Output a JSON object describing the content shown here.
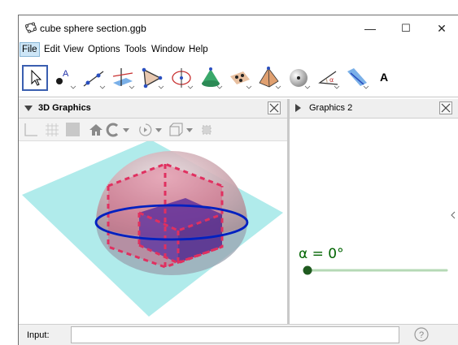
{
  "window": {
    "title": "cube sphere section.ggb",
    "minimize": "—",
    "maximize": "☐",
    "close": "✕"
  },
  "menu": [
    "File",
    "Edit",
    "View",
    "Options",
    "Tools",
    "Window",
    "Help"
  ],
  "toolbar": {
    "tools": [
      "move-tool",
      "point-tool",
      "line-tool",
      "perpendicular-tool",
      "polygon-tool",
      "circle-tool",
      "cone-tool",
      "plane-tool",
      "pyramid-tool",
      "sphere-tool",
      "angle-tool",
      "reflect-tool",
      "text-tool"
    ],
    "text_tool_label": "A"
  },
  "panel_3d": {
    "title": "3D Graphics",
    "close": "✕"
  },
  "panel_2d": {
    "title": "Graphics 2",
    "close": "✕"
  },
  "slider": {
    "label": "α = 0°",
    "value": 0
  },
  "input_bar": {
    "label": "Input:",
    "value": "",
    "help": "?"
  },
  "colors": {
    "sphere": "#c8a0a8",
    "cube": "#e0446a",
    "circle": "#0020c0",
    "plane": "#7fe0e0",
    "slider": "#006400",
    "accent": "#3a5fb0"
  }
}
